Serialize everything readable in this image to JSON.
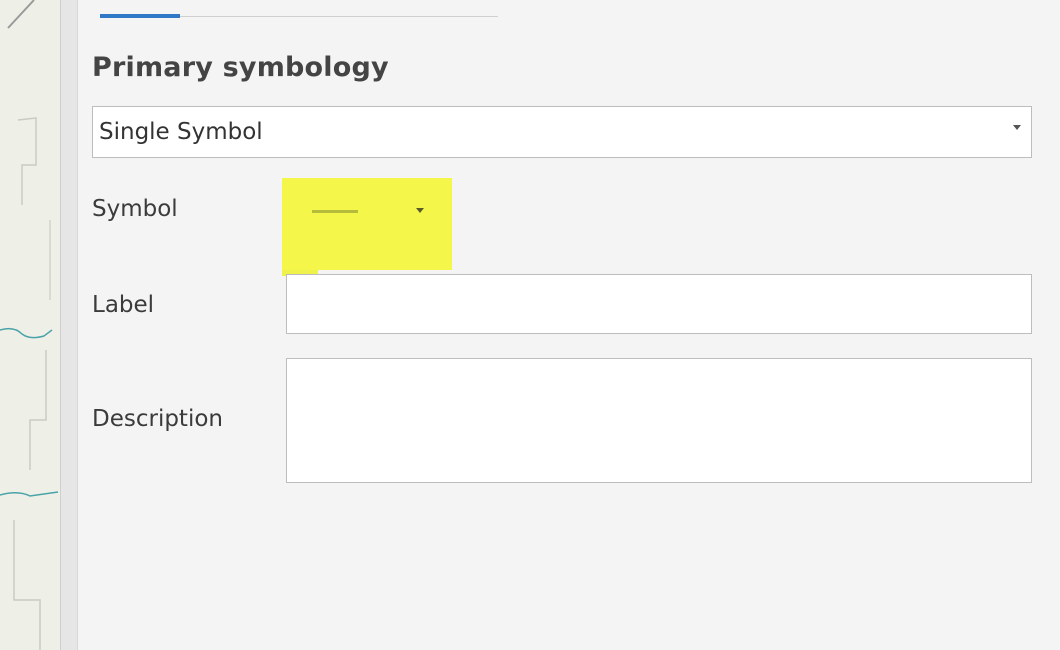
{
  "panel": {
    "section_title": "Primary symbology",
    "symbology_dropdown": {
      "selected": "Single Symbol"
    },
    "symbol": {
      "label": "Symbol",
      "line_color": "#b5bb3a",
      "highlight_color": "#f4f64a"
    },
    "label_field": {
      "label": "Label",
      "value": ""
    },
    "description_field": {
      "label": "Description",
      "value": ""
    }
  },
  "colors": {
    "accent": "#2e78c6",
    "panel_bg": "#f4f4f4",
    "input_border": "#bdbdbd"
  }
}
